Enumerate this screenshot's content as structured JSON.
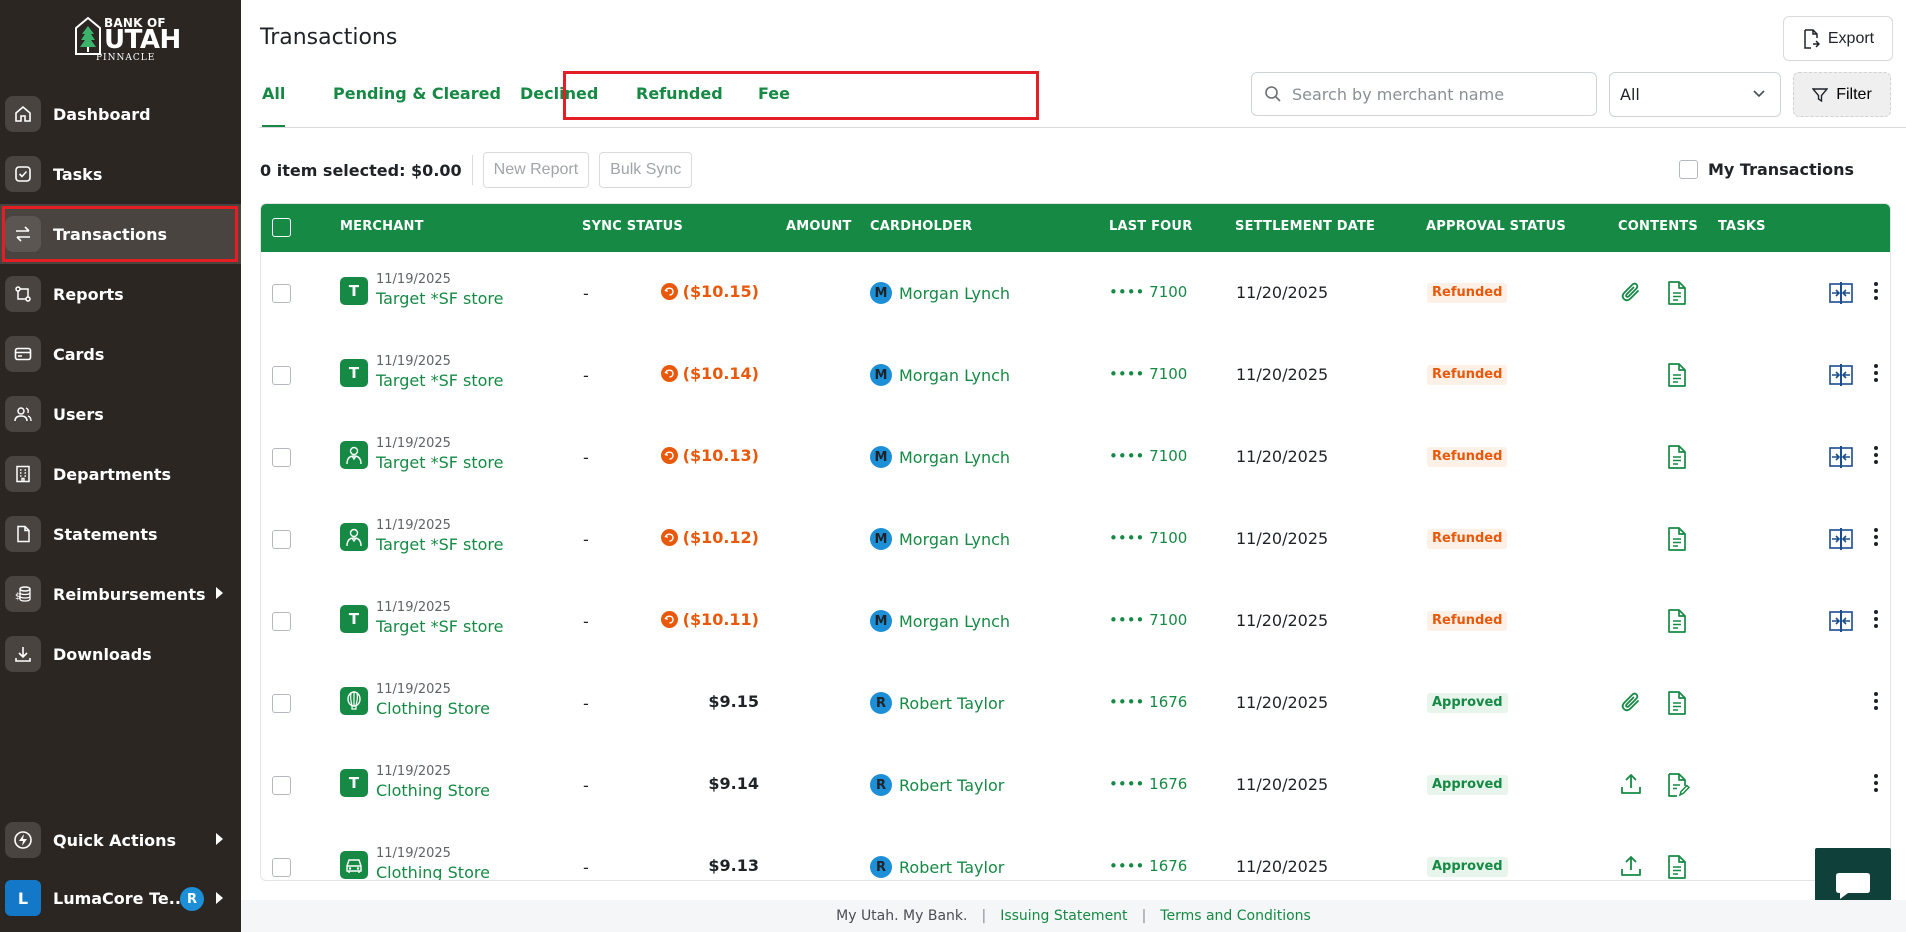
{
  "brand": {
    "line1": "BANK OF",
    "line2": "UTAH",
    "line3": "PINNACLE"
  },
  "sidebar": {
    "items": [
      {
        "label": "Dashboard",
        "icon": "home-icon"
      },
      {
        "label": "Tasks",
        "icon": "check-circle-icon"
      },
      {
        "label": "Transactions",
        "icon": "transfer-arrows-icon",
        "active": true
      },
      {
        "label": "Reports",
        "icon": "report-icon"
      },
      {
        "label": "Cards",
        "icon": "card-icon"
      },
      {
        "label": "Users",
        "icon": "users-icon"
      },
      {
        "label": "Departments",
        "icon": "building-icon"
      },
      {
        "label": "Statements",
        "icon": "document-icon"
      },
      {
        "label": "Reimbursements",
        "icon": "money-stack-icon",
        "has_submenu": true
      },
      {
        "label": "Downloads",
        "icon": "download-icon"
      }
    ],
    "quick_actions": "Quick Actions",
    "team": {
      "initial": "L",
      "label": "LumaCore Te...",
      "user_initial": "R"
    }
  },
  "header": {
    "title": "Transactions",
    "export": "Export"
  },
  "tabs": [
    "All",
    "Pending & Cleared",
    "Declined",
    "Refunded",
    "Fee"
  ],
  "search": {
    "placeholder": "Search by merchant name",
    "value": ""
  },
  "select": {
    "value": "All"
  },
  "filter": "Filter",
  "selection": {
    "text": "0 item selected: $0.00",
    "new_report": "New Report",
    "bulk_sync": "Bulk Sync",
    "my_transactions": "My Transactions"
  },
  "table": {
    "columns": [
      "MERCHANT",
      "SYNC STATUS",
      "AMOUNT",
      "CARDHOLDER",
      "LAST FOUR",
      "SETTLEMENT DATE",
      "APPROVAL STATUS",
      "CONTENTS",
      "TASKS"
    ],
    "rows": [
      {
        "date": "11/19/2025",
        "merchant": "Target *SF store",
        "merchant_icon": "T",
        "sync": "-",
        "amount": "($10.15)",
        "refund": true,
        "holder_initial": "M",
        "holder": "Morgan Lynch",
        "last_four": "•••• 7100",
        "settlement": "11/20/2025",
        "status": "Refunded",
        "attachment": "paperclip",
        "receipt": "doc",
        "compare": true
      },
      {
        "date": "11/19/2025",
        "merchant": "Target *SF store",
        "merchant_icon": "T",
        "sync": "-",
        "amount": "($10.14)",
        "refund": true,
        "holder_initial": "M",
        "holder": "Morgan Lynch",
        "last_four": "•••• 7100",
        "settlement": "11/20/2025",
        "status": "Refunded",
        "attachment": "",
        "receipt": "doc",
        "compare": true
      },
      {
        "date": "11/19/2025",
        "merchant": "Target *SF store",
        "merchant_icon": "person",
        "sync": "-",
        "amount": "($10.13)",
        "refund": true,
        "holder_initial": "M",
        "holder": "Morgan Lynch",
        "last_four": "•••• 7100",
        "settlement": "11/20/2025",
        "status": "Refunded",
        "attachment": "",
        "receipt": "doc",
        "compare": true
      },
      {
        "date": "11/19/2025",
        "merchant": "Target *SF store",
        "merchant_icon": "person",
        "sync": "-",
        "amount": "($10.12)",
        "refund": true,
        "holder_initial": "M",
        "holder": "Morgan Lynch",
        "last_four": "•••• 7100",
        "settlement": "11/20/2025",
        "status": "Refunded",
        "attachment": "",
        "receipt": "doc",
        "compare": true
      },
      {
        "date": "11/19/2025",
        "merchant": "Target *SF store",
        "merchant_icon": "T",
        "sync": "-",
        "amount": "($10.11)",
        "refund": true,
        "holder_initial": "M",
        "holder": "Morgan Lynch",
        "last_four": "•••• 7100",
        "settlement": "11/20/2025",
        "status": "Refunded",
        "attachment": "",
        "receipt": "doc",
        "compare": true
      },
      {
        "date": "11/19/2025",
        "merchant": "Clothing Store",
        "merchant_icon": "balloon",
        "sync": "-",
        "amount": "$9.15",
        "refund": false,
        "holder_initial": "R",
        "holder": "Robert Taylor",
        "last_four": "•••• 1676",
        "settlement": "11/20/2025",
        "status": "Approved",
        "attachment": "paperclip",
        "receipt": "doc",
        "compare": false
      },
      {
        "date": "11/19/2025",
        "merchant": "Clothing Store",
        "merchant_icon": "T",
        "sync": "-",
        "amount": "$9.14",
        "refund": false,
        "holder_initial": "R",
        "holder": "Robert Taylor",
        "last_four": "•••• 1676",
        "settlement": "11/20/2025",
        "status": "Approved",
        "attachment": "upload",
        "receipt": "doc-edit",
        "compare": false
      },
      {
        "date": "11/19/2025",
        "merchant": "Clothing Store",
        "merchant_icon": "car",
        "sync": "-",
        "amount": "$9.13",
        "refund": false,
        "holder_initial": "R",
        "holder": "Robert Taylor",
        "last_four": "•••• 1676",
        "settlement": "11/20/2025",
        "status": "Approved",
        "attachment": "upload",
        "receipt": "doc",
        "compare": false
      }
    ]
  },
  "footer": {
    "tagline": "My Utah. My Bank.",
    "link1": "Issuing Statement",
    "link2": "Terms and Conditions"
  },
  "colors": {
    "sidebar_bg": "#2b2622",
    "brand_green": "#168a45",
    "refund_orange": "#e8590c",
    "highlight_red": "#e31e24"
  }
}
